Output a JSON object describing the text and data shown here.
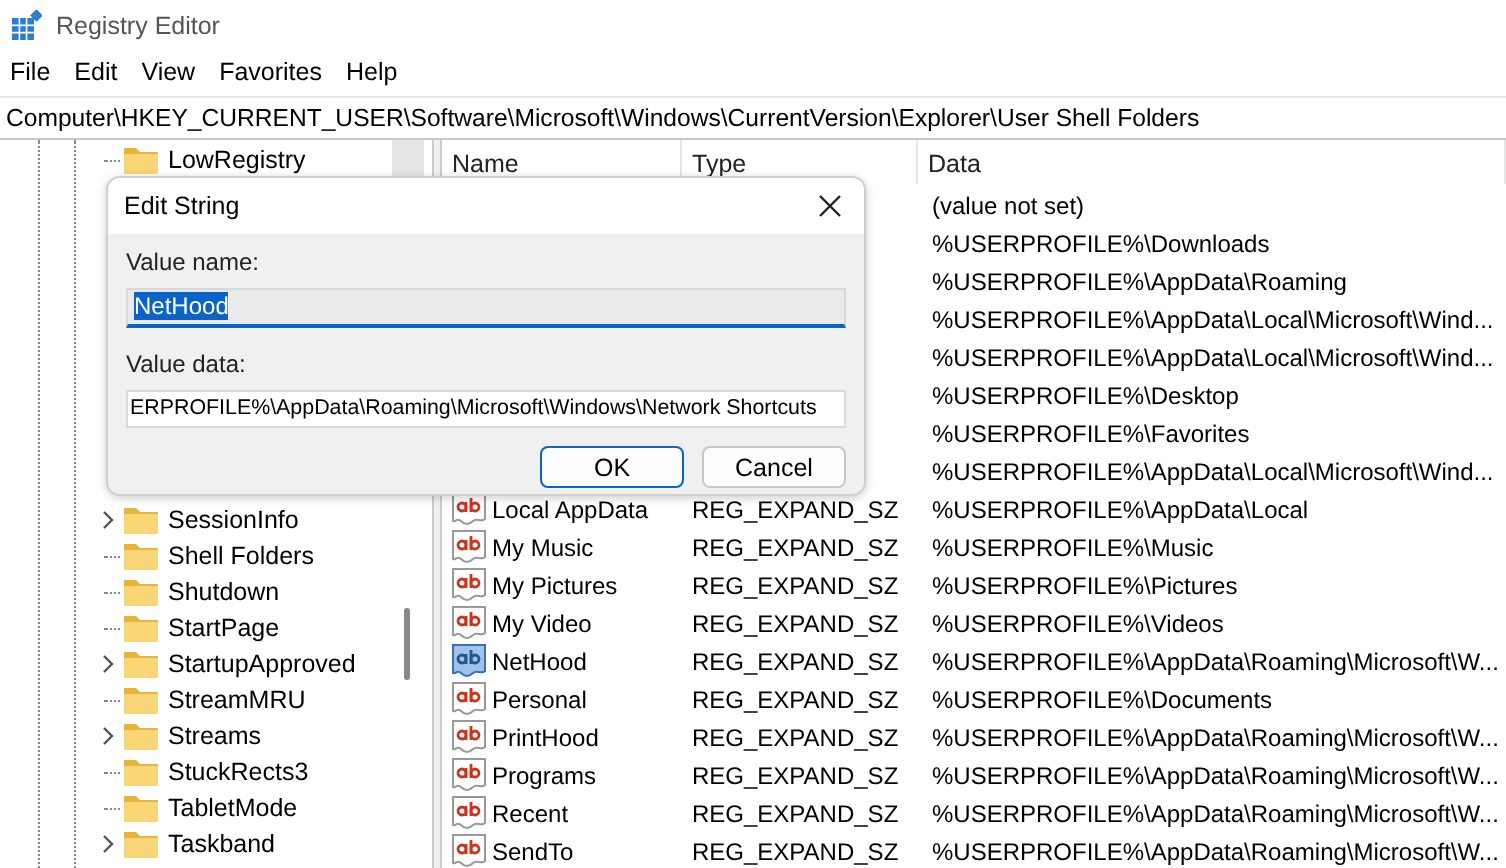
{
  "window": {
    "title": "Registry Editor"
  },
  "menu": [
    "File",
    "Edit",
    "View",
    "Favorites",
    "Help"
  ],
  "address": "Computer\\HKEY_CURRENT_USER\\Software\\Microsoft\\Windows\\CurrentVersion\\Explorer\\User Shell Folders",
  "tree": {
    "items_top": [
      {
        "label": "LowRegistry",
        "has_children": false
      }
    ],
    "items_bottom": [
      {
        "label": "SessionInfo",
        "has_children": true
      },
      {
        "label": "Shell Folders",
        "has_children": false
      },
      {
        "label": "Shutdown",
        "has_children": false
      },
      {
        "label": "StartPage",
        "has_children": false
      },
      {
        "label": "StartupApproved",
        "has_children": true
      },
      {
        "label": "StreamMRU",
        "has_children": false
      },
      {
        "label": "Streams",
        "has_children": true
      },
      {
        "label": "StuckRects3",
        "has_children": false
      },
      {
        "label": "TabletMode",
        "has_children": false
      },
      {
        "label": "Taskband",
        "has_children": true
      }
    ]
  },
  "table": {
    "columns": [
      "Name",
      "Type",
      "Data"
    ],
    "rows": [
      {
        "data": "(value not set)"
      },
      {
        "data": "%USERPROFILE%\\Downloads"
      },
      {
        "data": "%USERPROFILE%\\AppData\\Roaming"
      },
      {
        "data": "%USERPROFILE%\\AppData\\Local\\Microsoft\\Wind..."
      },
      {
        "data": "%USERPROFILE%\\AppData\\Local\\Microsoft\\Wind..."
      },
      {
        "data": "%USERPROFILE%\\Desktop"
      },
      {
        "data": "%USERPROFILE%\\Favorites"
      },
      {
        "data": "%USERPROFILE%\\AppData\\Local\\Microsoft\\Wind..."
      },
      {
        "name": "Local AppData",
        "type": "REG_EXPAND_SZ",
        "data": "%USERPROFILE%\\AppData\\Local",
        "selected": false
      },
      {
        "name": "My Music",
        "type": "REG_EXPAND_SZ",
        "data": "%USERPROFILE%\\Music",
        "selected": false
      },
      {
        "name": "My Pictures",
        "type": "REG_EXPAND_SZ",
        "data": "%USERPROFILE%\\Pictures",
        "selected": false
      },
      {
        "name": "My Video",
        "type": "REG_EXPAND_SZ",
        "data": "%USERPROFILE%\\Videos",
        "selected": false
      },
      {
        "name": "NetHood",
        "type": "REG_EXPAND_SZ",
        "data": "%USERPROFILE%\\AppData\\Roaming\\Microsoft\\W...",
        "selected": true
      },
      {
        "name": "Personal",
        "type": "REG_EXPAND_SZ",
        "data": "%USERPROFILE%\\Documents",
        "selected": false
      },
      {
        "name": "PrintHood",
        "type": "REG_EXPAND_SZ",
        "data": "%USERPROFILE%\\AppData\\Roaming\\Microsoft\\W...",
        "selected": false
      },
      {
        "name": "Programs",
        "type": "REG_EXPAND_SZ",
        "data": "%USERPROFILE%\\AppData\\Roaming\\Microsoft\\W...",
        "selected": false
      },
      {
        "name": "Recent",
        "type": "REG_EXPAND_SZ",
        "data": "%USERPROFILE%\\AppData\\Roaming\\Microsoft\\W...",
        "selected": false
      },
      {
        "name": "SendTo",
        "type": "REG_EXPAND_SZ",
        "data": "%USERPROFILE%\\AppData\\Roaming\\Microsoft\\W...",
        "selected": false
      }
    ]
  },
  "dialog": {
    "title": "Edit String",
    "name_label": "Value name:",
    "name_value": "NetHood",
    "name_value_selected": true,
    "data_label": "Value data:",
    "data_value": "ERPROFILE%\\AppData\\Roaming\\Microsoft\\Windows\\Network Shortcuts",
    "buttons": [
      {
        "label": "OK",
        "default": true
      },
      {
        "label": "Cancel",
        "default": false
      }
    ]
  }
}
